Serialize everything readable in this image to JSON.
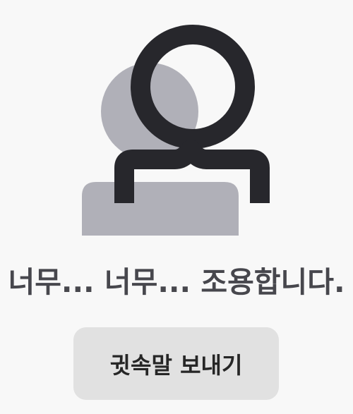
{
  "empty_state": {
    "illustration_icon": "empty-people-icon",
    "message": "너무... 너무... 조용합니다.",
    "whisper_button_label": "귓속말 보내기"
  },
  "colors": {
    "background": "#f8f8f8",
    "back_person": "#b0b0b8",
    "front_person_outline": "#27272c",
    "message_text": "#47474d",
    "button_bg": "#e1e1e1",
    "button_text": "#262626"
  }
}
